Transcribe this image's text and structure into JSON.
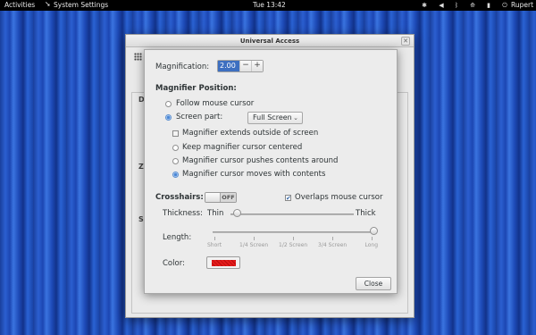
{
  "topbar": {
    "activities": "Activities",
    "app_name": "System Settings",
    "clock": "Tue 13:42",
    "user": "Rupert",
    "icons": [
      "accessibility-icon",
      "volume-icon",
      "bluetooth-icon",
      "network-icon",
      "battery-icon",
      "power-icon"
    ]
  },
  "background_window": {
    "title": "Universal Access",
    "fragments": [
      "D",
      "Z",
      "S"
    ]
  },
  "dialog": {
    "magnification": {
      "label": "Magnification:",
      "value": "2.00",
      "minus": "−",
      "plus": "+"
    },
    "position": {
      "heading": "Magnifier Position:",
      "follow_mouse": "Follow mouse cursor",
      "screen_part": "Screen part:",
      "screen_part_value": "Full Screen",
      "extends_outside": "Magnifier extends outside of screen",
      "keep_centered": "Keep magnifier cursor centered",
      "pushes_contents": "Magnifier cursor pushes contents around",
      "moves_with_contents": "Magnifier cursor moves with contents"
    },
    "crosshairs": {
      "label": "Crosshairs:",
      "toggle_state": "OFF",
      "overlaps_label": "Overlaps mouse cursor",
      "overlaps_checked": true,
      "thickness_label": "Thickness:",
      "thin": "Thin",
      "thick": "Thick",
      "thickness_value": 0.05,
      "length_label": "Length:",
      "length_ticks": [
        "Short",
        "1/4 Screen",
        "1/2 Screen",
        "3/4 Screen",
        "Long"
      ],
      "length_value": 1.0,
      "color_label": "Color:",
      "color_value": "#e41b1b"
    },
    "close_label": "Close"
  }
}
